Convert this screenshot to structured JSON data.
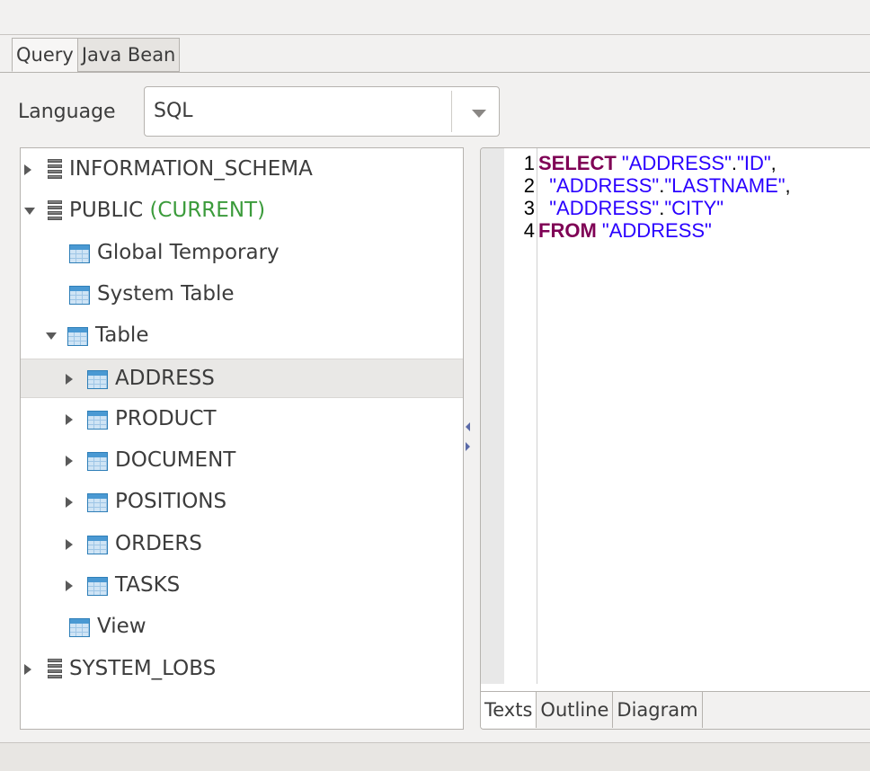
{
  "tabs": [
    {
      "label": "Query",
      "active": true
    },
    {
      "label": "Java Bean",
      "active": false
    }
  ],
  "language": {
    "label": "Language",
    "value": "SQL"
  },
  "tree": {
    "items": [
      {
        "label": "INFORMATION_SCHEMA",
        "suffix": "",
        "icon": "database-icon",
        "expander": "collapsed"
      },
      {
        "label": "PUBLIC",
        "suffix": "(CURRENT)",
        "icon": "database-icon",
        "expander": "expanded"
      },
      {
        "label": "Global Temporary",
        "suffix": "",
        "icon": "table-icon",
        "expander": "none"
      },
      {
        "label": "System Table",
        "suffix": "",
        "icon": "table-icon",
        "expander": "none"
      },
      {
        "label": "Table",
        "suffix": "",
        "icon": "table-icon",
        "expander": "expanded"
      },
      {
        "label": "ADDRESS",
        "suffix": "",
        "icon": "table-icon",
        "expander": "collapsed",
        "selected": true
      },
      {
        "label": "PRODUCT",
        "suffix": "",
        "icon": "table-icon",
        "expander": "collapsed"
      },
      {
        "label": "DOCUMENT",
        "suffix": "",
        "icon": "table-icon",
        "expander": "collapsed"
      },
      {
        "label": "POSITIONS",
        "suffix": "",
        "icon": "table-icon",
        "expander": "collapsed"
      },
      {
        "label": "ORDERS",
        "suffix": "",
        "icon": "table-icon",
        "expander": "collapsed"
      },
      {
        "label": "TASKS",
        "suffix": "",
        "icon": "table-icon",
        "expander": "collapsed"
      },
      {
        "label": "View",
        "suffix": "",
        "icon": "table-icon",
        "expander": "none"
      },
      {
        "label": "SYSTEM_LOBS",
        "suffix": "",
        "icon": "database-icon",
        "expander": "collapsed"
      }
    ]
  },
  "editor": {
    "lines": [
      {
        "num": "1",
        "parts": [
          {
            "t": "kw",
            "v": "SELECT"
          },
          {
            "t": "plain",
            "v": " "
          },
          {
            "t": "str",
            "v": "\"ADDRESS\""
          },
          {
            "t": "plain",
            "v": "."
          },
          {
            "t": "str",
            "v": "\"ID\""
          },
          {
            "t": "plain",
            "v": ","
          }
        ]
      },
      {
        "num": "2",
        "parts": [
          {
            "t": "plain",
            "v": "  "
          },
          {
            "t": "str",
            "v": "\"ADDRESS\""
          },
          {
            "t": "plain",
            "v": "."
          },
          {
            "t": "str",
            "v": "\"LASTNAME\""
          },
          {
            "t": "plain",
            "v": ","
          }
        ]
      },
      {
        "num": "3",
        "parts": [
          {
            "t": "plain",
            "v": "  "
          },
          {
            "t": "str",
            "v": "\"ADDRESS\""
          },
          {
            "t": "plain",
            "v": "."
          },
          {
            "t": "str",
            "v": "\"CITY\""
          }
        ]
      },
      {
        "num": "4",
        "parts": [
          {
            "t": "kw",
            "v": "FROM"
          },
          {
            "t": "plain",
            "v": " "
          },
          {
            "t": "str",
            "v": "\"ADDRESS\""
          }
        ]
      }
    ],
    "tabs": [
      {
        "label": "Texts",
        "active": true
      },
      {
        "label": "Outline",
        "active": false
      },
      {
        "label": "Diagram",
        "active": false
      }
    ]
  },
  "colors": {
    "keyword": "#7f0055",
    "string": "#2a00ff",
    "current": "#3b9b3b",
    "selection": "#e9e8e6"
  }
}
